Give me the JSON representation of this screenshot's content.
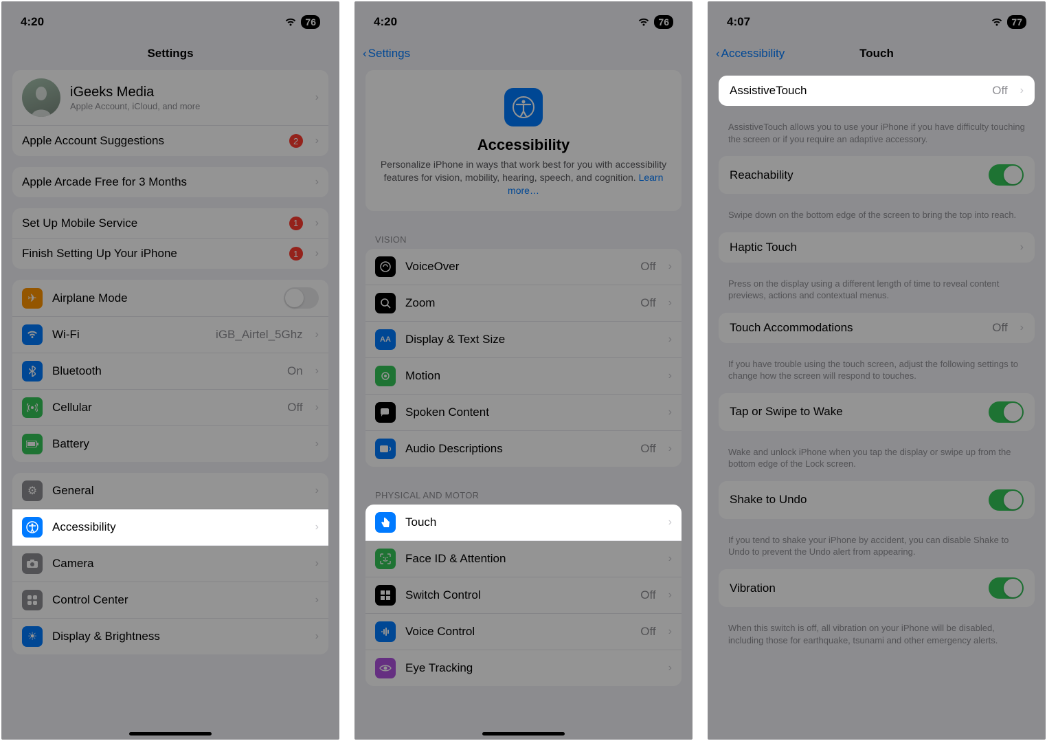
{
  "phone1": {
    "time": "4:20",
    "battery": "76",
    "title": "Settings",
    "profile": {
      "name": "iGeeks Media",
      "sub": "Apple Account, iCloud, and more"
    },
    "suggestions": {
      "label": "Apple Account Suggestions",
      "badge": "2"
    },
    "arcade": "Apple Arcade Free for 3 Months",
    "setup_mobile": {
      "label": "Set Up Mobile Service",
      "badge": "1"
    },
    "finish_setup": {
      "label": "Finish Setting Up Your iPhone",
      "badge": "1"
    },
    "airplane": "Airplane Mode",
    "wifi": {
      "label": "Wi-Fi",
      "value": "iGB_Airtel_5Ghz"
    },
    "bluetooth": {
      "label": "Bluetooth",
      "value": "On"
    },
    "cellular": {
      "label": "Cellular",
      "value": "Off"
    },
    "battery_row": "Battery",
    "general": "General",
    "accessibility": "Accessibility",
    "camera": "Camera",
    "control": "Control Center",
    "display": "Display & Brightness"
  },
  "phone2": {
    "time": "4:20",
    "battery": "76",
    "back": "Settings",
    "hero_title": "Accessibility",
    "hero_desc": "Personalize iPhone in ways that work best for you with accessibility features for vision, mobility, hearing, speech, and cognition. ",
    "learn_more": "Learn more…",
    "section_vision": "VISION",
    "voiceover": {
      "label": "VoiceOver",
      "value": "Off"
    },
    "zoom": {
      "label": "Zoom",
      "value": "Off"
    },
    "textsize": "Display & Text Size",
    "motion": "Motion",
    "spoken": "Spoken Content",
    "audio": {
      "label": "Audio Descriptions",
      "value": "Off"
    },
    "section_motor": "PHYSICAL AND MOTOR",
    "touch": "Touch",
    "faceid": "Face ID & Attention",
    "switch": {
      "label": "Switch Control",
      "value": "Off"
    },
    "voice": {
      "label": "Voice Control",
      "value": "Off"
    },
    "eye": "Eye Tracking"
  },
  "phone3": {
    "time": "4:07",
    "battery": "77",
    "back": "Accessibility",
    "title": "Touch",
    "assistive": {
      "label": "AssistiveTouch",
      "value": "Off"
    },
    "assistive_note": "AssistiveTouch allows you to use your iPhone if you have difficulty touching the screen or if you require an adaptive accessory.",
    "reachability": "Reachability",
    "reachability_note": "Swipe down on the bottom edge of the screen to bring the top into reach.",
    "haptic": "Haptic Touch",
    "haptic_note": "Press on the display using a different length of time to reveal content previews, actions and contextual menus.",
    "touchacc": {
      "label": "Touch Accommodations",
      "value": "Off"
    },
    "touchacc_note": "If you have trouble using the touch screen, adjust the following settings to change how the screen will respond to touches.",
    "tapwake": "Tap or Swipe to Wake",
    "tapwake_note": "Wake and unlock iPhone when you tap the display or swipe up from the bottom edge of the Lock screen.",
    "shake": "Shake to Undo",
    "shake_note": "If you tend to shake your iPhone by accident, you can disable Shake to Undo to prevent the Undo alert from appearing.",
    "vibration": "Vibration",
    "vibration_note": "When this switch is off, all vibration on your iPhone will be disabled, including those for earthquake, tsunami and other emergency alerts."
  }
}
